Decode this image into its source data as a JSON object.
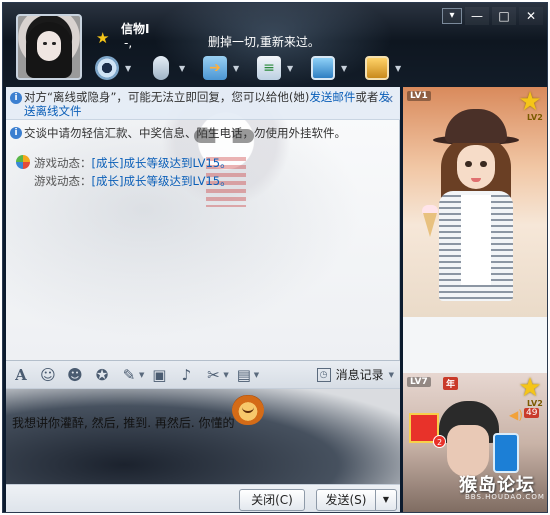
{
  "header": {
    "contact_name": "信物I",
    "contact_sub": "-,",
    "signature": "删掉一切,重新来过。",
    "window_controls": [
      "▾",
      "—",
      "□",
      "✕"
    ]
  },
  "toolbar_top": {
    "icons": [
      "webcam-icon",
      "microphone-icon",
      "file-transfer-icon",
      "message-doc-icon",
      "remote-desktop-icon",
      "app-box-icon"
    ]
  },
  "chat": {
    "notice": {
      "prefix": "对方“离线或隐身”，可能无法立即回复，您可以给他(她)",
      "link1": "发送邮件",
      "middle": "或者",
      "link2": "发送离线文件",
      "close": "✕"
    },
    "warning": "交谈中请勿轻信汇款、中奖信息、陌生电话，勿使用外挂软件。",
    "game_lines": [
      {
        "label": "游戏动态：",
        "link": "[成长]成长等级达到LV15。"
      },
      {
        "label": "游戏动态：",
        "link": "[成长]成长等级达到LV15。"
      }
    ]
  },
  "format_bar": {
    "history_label": "消息记录"
  },
  "input": {
    "text": "我想讲你灌醉, 然后, 推到. 再然后. 你懂的"
  },
  "buttons": {
    "close_label": "关闭(C)",
    "send_label": "发送(S)",
    "send_arrow": "▼"
  },
  "side": {
    "top_level": "LV1",
    "top_level2": "LV2",
    "bottom_level": "LV7",
    "bottom_year": "年",
    "bottom_level2": "LV2",
    "gift_count": "2",
    "volume_num": "49",
    "watermark": "猴岛论坛",
    "watermark_sub": "BBS.HOUDAO.COM"
  }
}
